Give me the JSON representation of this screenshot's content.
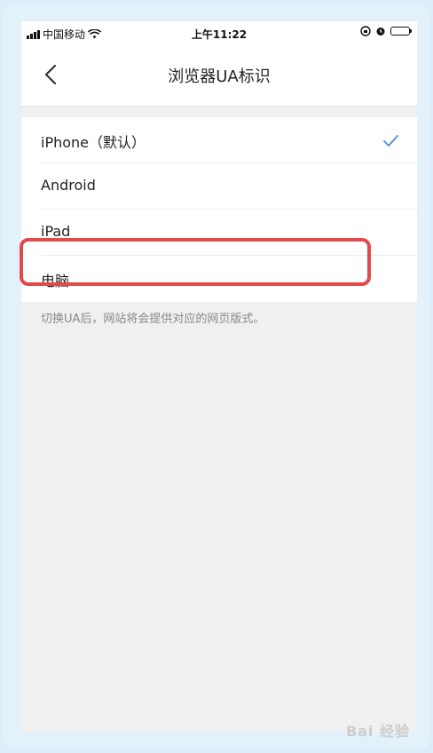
{
  "status_bar": {
    "carrier": "中国移动",
    "time": "上午11:22"
  },
  "nav": {
    "title": "浏览器UA标识",
    "back_icon": "chevron-left-icon"
  },
  "options": [
    {
      "label": "iPhone（默认）",
      "selected": true
    },
    {
      "label": "Android",
      "selected": false
    },
    {
      "label": "iPad",
      "selected": false
    },
    {
      "label": "电脑",
      "selected": false
    }
  ],
  "hint": "切换UA后，网站将会提供对应的网页版式。",
  "watermark": "Bai 经验",
  "colors": {
    "check": "#4a90e2",
    "highlight": "#e24a4a"
  }
}
